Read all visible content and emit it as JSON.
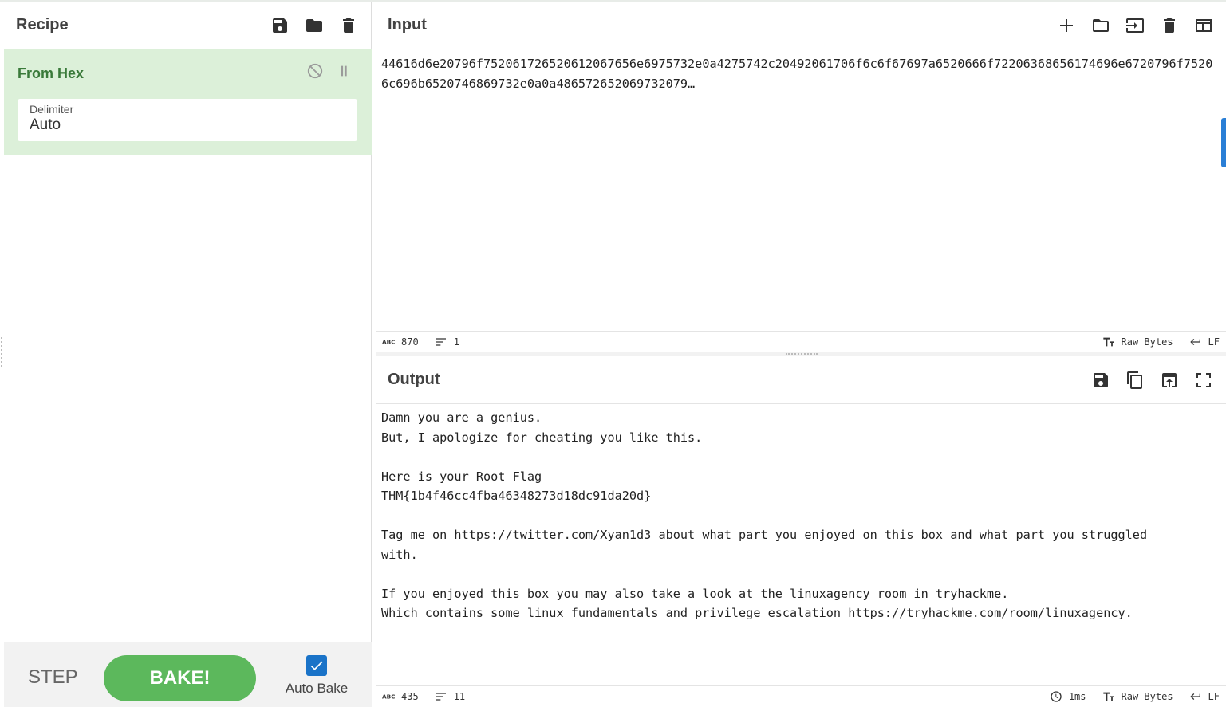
{
  "recipe": {
    "title": "Recipe",
    "icons": [
      "save-icon",
      "folder-icon",
      "trash-icon"
    ],
    "operation": {
      "name": "From Hex",
      "icons": [
        "disable-icon",
        "pause-icon"
      ],
      "field_label": "Delimiter",
      "field_value": "Auto"
    },
    "controls": {
      "step_label": "STEP",
      "bake_label": "BAKE!",
      "autobake_label": "Auto Bake",
      "autobake_checked": true
    }
  },
  "input": {
    "title": "Input",
    "icons": [
      "plus-icon",
      "folder-icon",
      "import-icon",
      "trash-icon",
      "layout-icon"
    ],
    "text": "44616d6e20796f752061726520612067656e6975732e0a4275742c20492061706f6c6f67697a6520666f72206368656174696e6720796f75206c696b6520746869732e0a0a486572652069732079…",
    "status": {
      "length": "870",
      "lines": "1",
      "encoding": "Raw Bytes",
      "eol": "LF"
    }
  },
  "output": {
    "title": "Output",
    "icons": [
      "save-icon",
      "copy-icon",
      "replace-input-icon",
      "maximize-icon"
    ],
    "text": "Damn you are a genius.\nBut, I apologize for cheating you like this.\n\nHere is your Root Flag\nTHM{1b4f46cc4fba46348273d18dc91da20d}\n\nTag me on https://twitter.com/Xyan1d3 about what part you enjoyed on this box and what part you struggled\nwith.\n\nIf you enjoyed this box you may also take a look at the linuxagency room in tryhackme.\nWhich contains some linux fundamentals and privilege escalation https://tryhackme.com/room/linuxagency.",
    "status": {
      "length": "435",
      "lines": "11",
      "time": "1ms",
      "encoding": "Raw Bytes",
      "eol": "LF"
    }
  },
  "colors": {
    "operation_bg": "#dcf0d9",
    "operation_title": "#3a7a3a",
    "bake_button": "#5cb85c",
    "checkbox": "#1a73c8"
  }
}
